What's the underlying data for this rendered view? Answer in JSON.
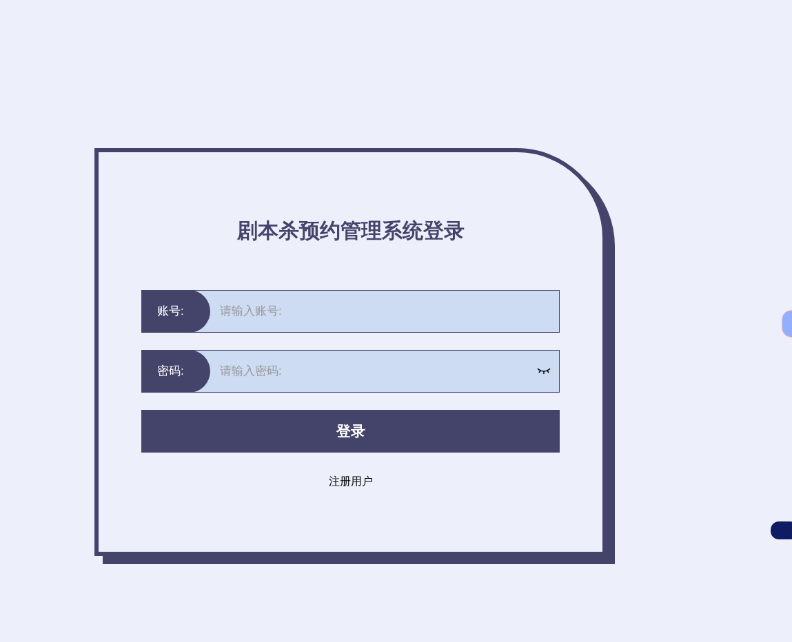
{
  "title": "剧本杀预约管理系统登录",
  "fields": [
    {
      "label": "账号:",
      "placeholder": "请输入账号:",
      "kind": "text"
    },
    {
      "label": "密码:",
      "placeholder": "请输入密码:",
      "kind": "password"
    }
  ],
  "login_button": "登录",
  "register_link": "注册用户"
}
